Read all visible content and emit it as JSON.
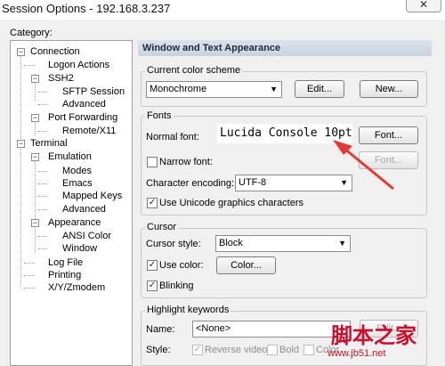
{
  "window": {
    "title": "Session Options - 192.168.3.237",
    "close_glyph": "✕"
  },
  "category": {
    "label": "Category:",
    "tree": [
      {
        "label": "Connection",
        "expander": "−"
      },
      {
        "label": "Logon Actions"
      },
      {
        "label": "SSH2",
        "expander": "−"
      },
      {
        "label": "SFTP Session"
      },
      {
        "label": "Advanced"
      },
      {
        "label": "Port Forwarding",
        "expander": "−"
      },
      {
        "label": "Remote/X11"
      },
      {
        "label": "Terminal",
        "expander": "−"
      },
      {
        "label": "Emulation",
        "expander": "−"
      },
      {
        "label": "Modes"
      },
      {
        "label": "Emacs"
      },
      {
        "label": "Mapped Keys"
      },
      {
        "label": "Advanced"
      },
      {
        "label": "Appearance",
        "expander": "−"
      },
      {
        "label": "ANSI Color"
      },
      {
        "label": "Window"
      },
      {
        "label": "Log File"
      },
      {
        "label": "Printing"
      },
      {
        "label": "X/Y/Zmodem"
      }
    ]
  },
  "panel": {
    "header": "Window and Text Appearance",
    "color_scheme": {
      "title": "Current color scheme",
      "value": "Monochrome",
      "edit_label": "Edit...",
      "new_label": "New..."
    },
    "fonts": {
      "title": "Fonts",
      "normal_font_label": "Normal font:",
      "normal_font_value": "Lucida Console 10pt",
      "font_button": "Font...",
      "narrow_font_label": "Narrow font:",
      "narrow_font_button": "Font...",
      "encoding_label": "Character encoding:",
      "encoding_value": "UTF-8",
      "unicode_graphics_label": "Use Unicode graphics characters"
    },
    "cursor": {
      "title": "Cursor",
      "style_label": "Cursor style:",
      "style_value": "Block",
      "use_color_label": "Use color:",
      "color_button": "Color...",
      "blinking_label": "Blinking"
    },
    "highlight": {
      "title": "Highlight keywords",
      "name_label": "Name:",
      "name_value": "<None>",
      "edit_button": "Edit...",
      "style_label": "Style:",
      "reverse_video_label": "Reverse video",
      "bold_label": "Bold",
      "color_label": "Color"
    }
  },
  "checkbox_mark": "✓",
  "dropdown_glyph": "▼",
  "annotation_color": "#e53935",
  "watermark": {
    "main": "脚本之家",
    "sub": "www.jb51.net"
  }
}
